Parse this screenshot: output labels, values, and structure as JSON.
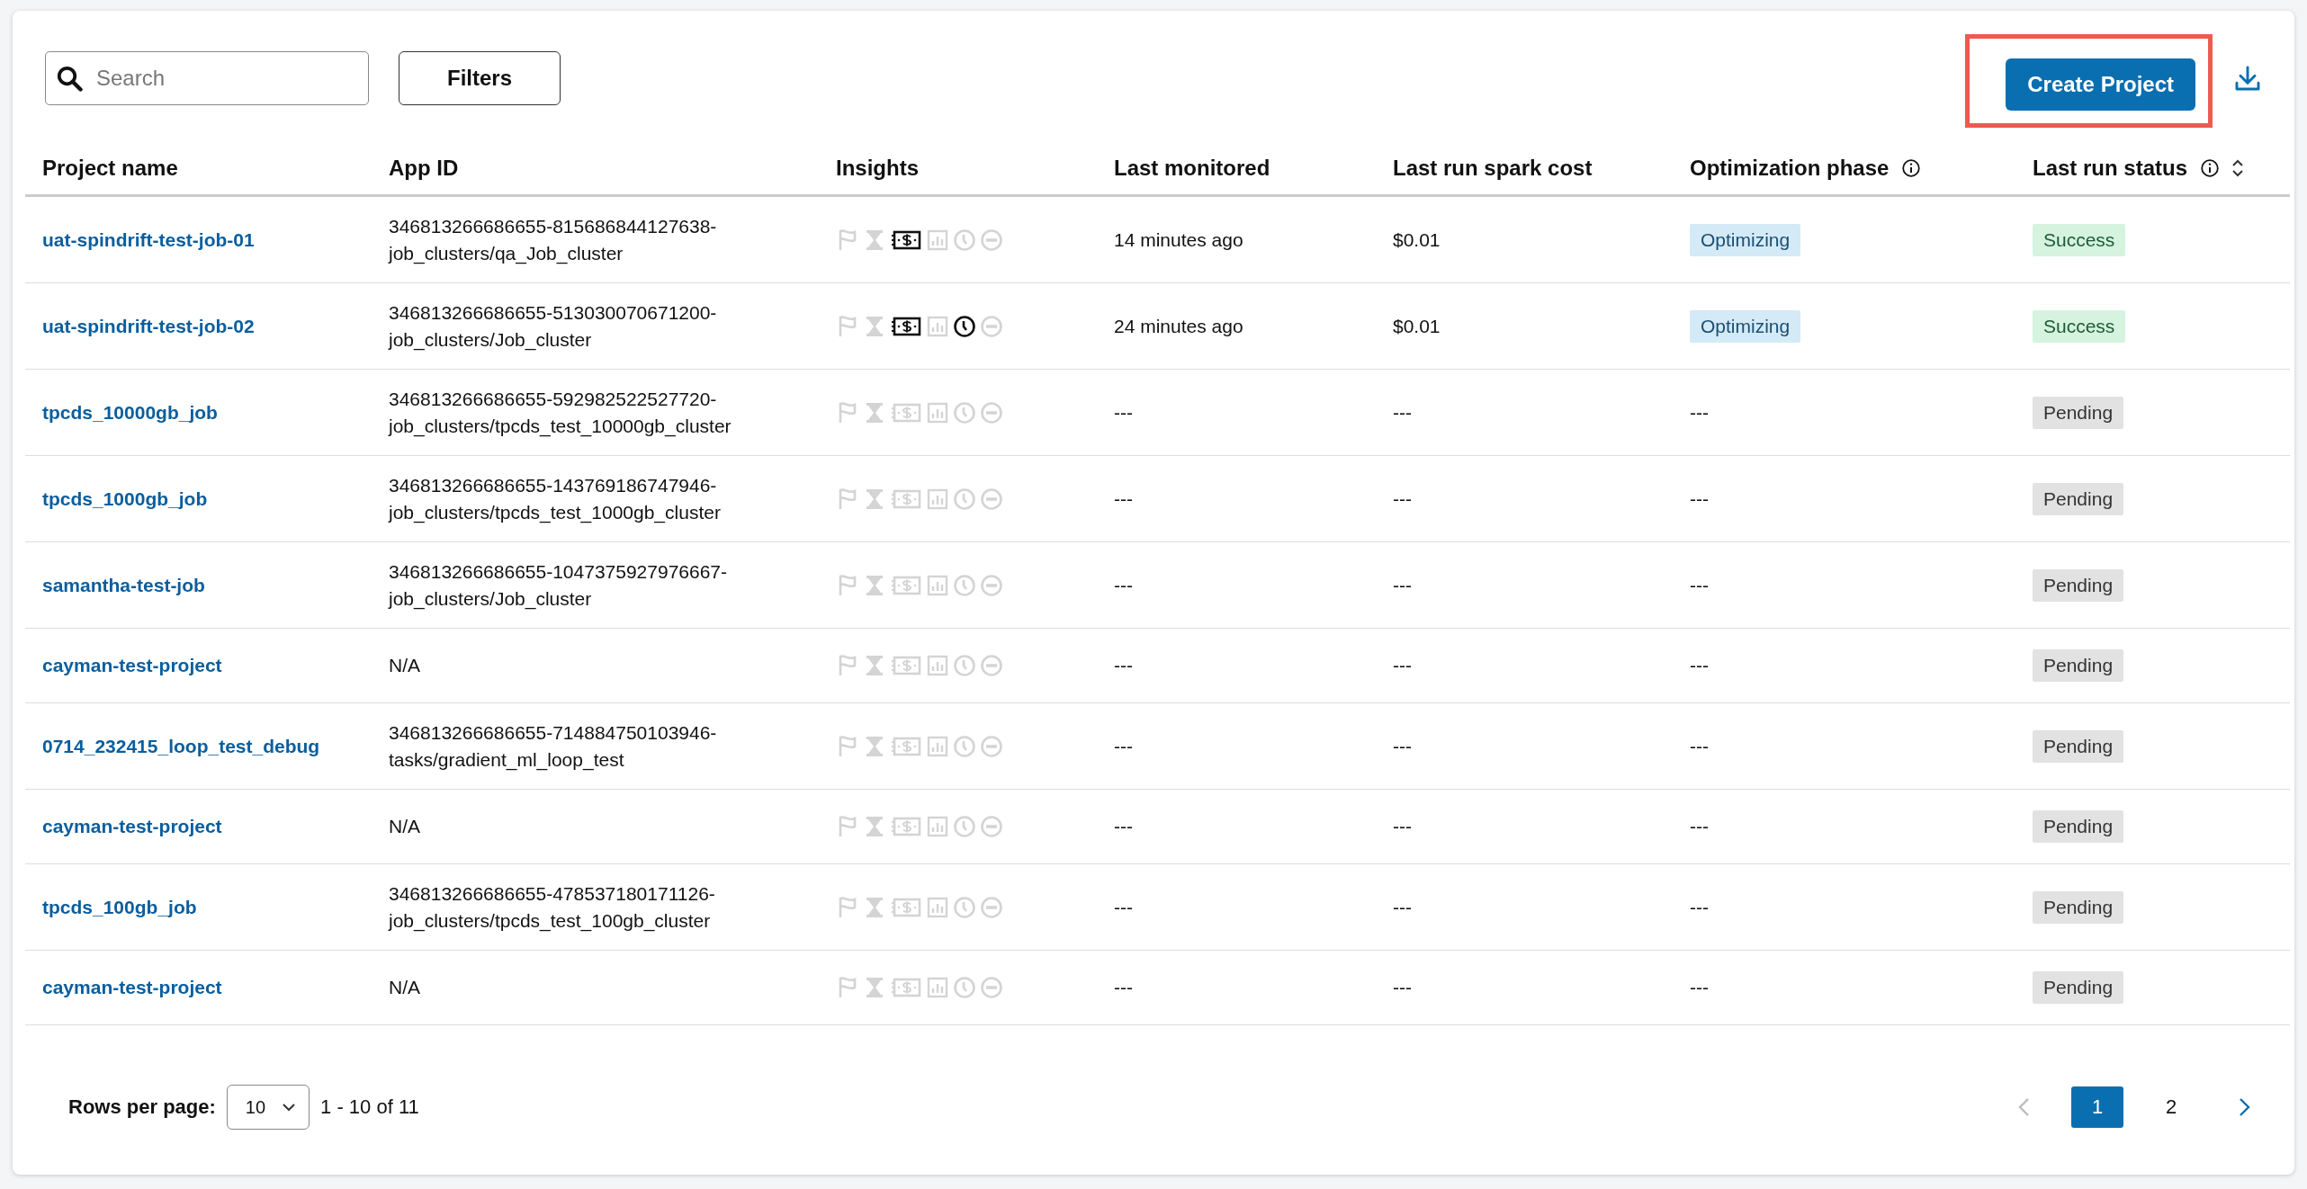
{
  "toolbar": {
    "search": {
      "placeholder": "Search"
    },
    "filters_button": "Filters",
    "create_button": {
      "label": "Create Project",
      "highlighted": true
    }
  },
  "table": {
    "columns": [
      {
        "label": "Project name",
        "info": false,
        "sortable": false
      },
      {
        "label": "App ID",
        "info": false,
        "sortable": false
      },
      {
        "label": "Insights",
        "info": false,
        "sortable": false
      },
      {
        "label": "Last monitored",
        "info": false,
        "sortable": false
      },
      {
        "label": "Last run spark cost",
        "info": false,
        "sortable": false
      },
      {
        "label": "Optimization phase",
        "info": true,
        "sortable": false
      },
      {
        "label": "Last run status",
        "info": true,
        "sortable": true
      }
    ],
    "rows": [
      {
        "name": "uat-spindrift-test-job-01",
        "app_id": [
          "346813266686655-815686844127638-",
          "job_clusters/qa_Job_cluster"
        ],
        "insights": [
          false,
          false,
          true,
          false,
          false,
          false
        ],
        "last_monitored": "14 minutes ago",
        "cost": "$0.01",
        "phase": {
          "text": "Optimizing",
          "kind": "badge"
        },
        "status": {
          "text": "Success",
          "kind": "success"
        }
      },
      {
        "name": "uat-spindrift-test-job-02",
        "app_id": [
          "346813266686655-513030070671200-",
          "job_clusters/Job_cluster"
        ],
        "insights": [
          false,
          false,
          true,
          false,
          true,
          false
        ],
        "last_monitored": "24 minutes ago",
        "cost": "$0.01",
        "phase": {
          "text": "Optimizing",
          "kind": "badge"
        },
        "status": {
          "text": "Success",
          "kind": "success"
        }
      },
      {
        "name": "tpcds_10000gb_job",
        "app_id": [
          "346813266686655-592982522527720-",
          "job_clusters/tpcds_test_10000gb_cluster"
        ],
        "insights": [
          false,
          false,
          false,
          false,
          false,
          false
        ],
        "last_monitored": "---",
        "cost": "---",
        "phase": {
          "text": "---",
          "kind": "plain"
        },
        "status": {
          "text": "Pending",
          "kind": "pending"
        }
      },
      {
        "name": "tpcds_1000gb_job",
        "app_id": [
          "346813266686655-143769186747946-",
          "job_clusters/tpcds_test_1000gb_cluster"
        ],
        "insights": [
          false,
          false,
          false,
          false,
          false,
          false
        ],
        "last_monitored": "---",
        "cost": "---",
        "phase": {
          "text": "---",
          "kind": "plain"
        },
        "status": {
          "text": "Pending",
          "kind": "pending"
        }
      },
      {
        "name": "samantha-test-job",
        "app_id": [
          "346813266686655-1047375927976667-",
          "job_clusters/Job_cluster"
        ],
        "insights": [
          false,
          false,
          false,
          false,
          false,
          false
        ],
        "last_monitored": "---",
        "cost": "---",
        "phase": {
          "text": "---",
          "kind": "plain"
        },
        "status": {
          "text": "Pending",
          "kind": "pending"
        }
      },
      {
        "name": "cayman-test-project",
        "app_id": [
          "N/A"
        ],
        "insights": [
          false,
          false,
          false,
          false,
          false,
          false
        ],
        "last_monitored": "---",
        "cost": "---",
        "phase": {
          "text": "---",
          "kind": "plain"
        },
        "status": {
          "text": "Pending",
          "kind": "pending"
        }
      },
      {
        "name": "0714_232415_loop_test_debug",
        "app_id": [
          "346813266686655-714884750103946-",
          "tasks/gradient_ml_loop_test"
        ],
        "insights": [
          false,
          false,
          false,
          false,
          false,
          false
        ],
        "last_monitored": "---",
        "cost": "---",
        "phase": {
          "text": "---",
          "kind": "plain"
        },
        "status": {
          "text": "Pending",
          "kind": "pending"
        }
      },
      {
        "name": "cayman-test-project",
        "app_id": [
          "N/A"
        ],
        "insights": [
          false,
          false,
          false,
          false,
          false,
          false
        ],
        "last_monitored": "---",
        "cost": "---",
        "phase": {
          "text": "---",
          "kind": "plain"
        },
        "status": {
          "text": "Pending",
          "kind": "pending"
        }
      },
      {
        "name": "tpcds_100gb_job",
        "app_id": [
          "346813266686655-478537180171126-",
          "job_clusters/tpcds_test_100gb_cluster"
        ],
        "insights": [
          false,
          false,
          false,
          false,
          false,
          false
        ],
        "last_monitored": "---",
        "cost": "---",
        "phase": {
          "text": "---",
          "kind": "plain"
        },
        "status": {
          "text": "Pending",
          "kind": "pending"
        }
      },
      {
        "name": "cayman-test-project",
        "app_id": [
          "N/A"
        ],
        "insights": [
          false,
          false,
          false,
          false,
          false,
          false
        ],
        "last_monitored": "---",
        "cost": "---",
        "phase": {
          "text": "---",
          "kind": "plain"
        },
        "status": {
          "text": "Pending",
          "kind": "pending"
        }
      }
    ]
  },
  "footer": {
    "rows_per_page_label": "Rows per page:",
    "rows_per_page_value": "10",
    "range": "1 - 10 of 11",
    "prev_disabled": true,
    "pages": [
      {
        "label": "1",
        "selected": true
      },
      {
        "label": "2",
        "selected": false
      }
    ]
  }
}
